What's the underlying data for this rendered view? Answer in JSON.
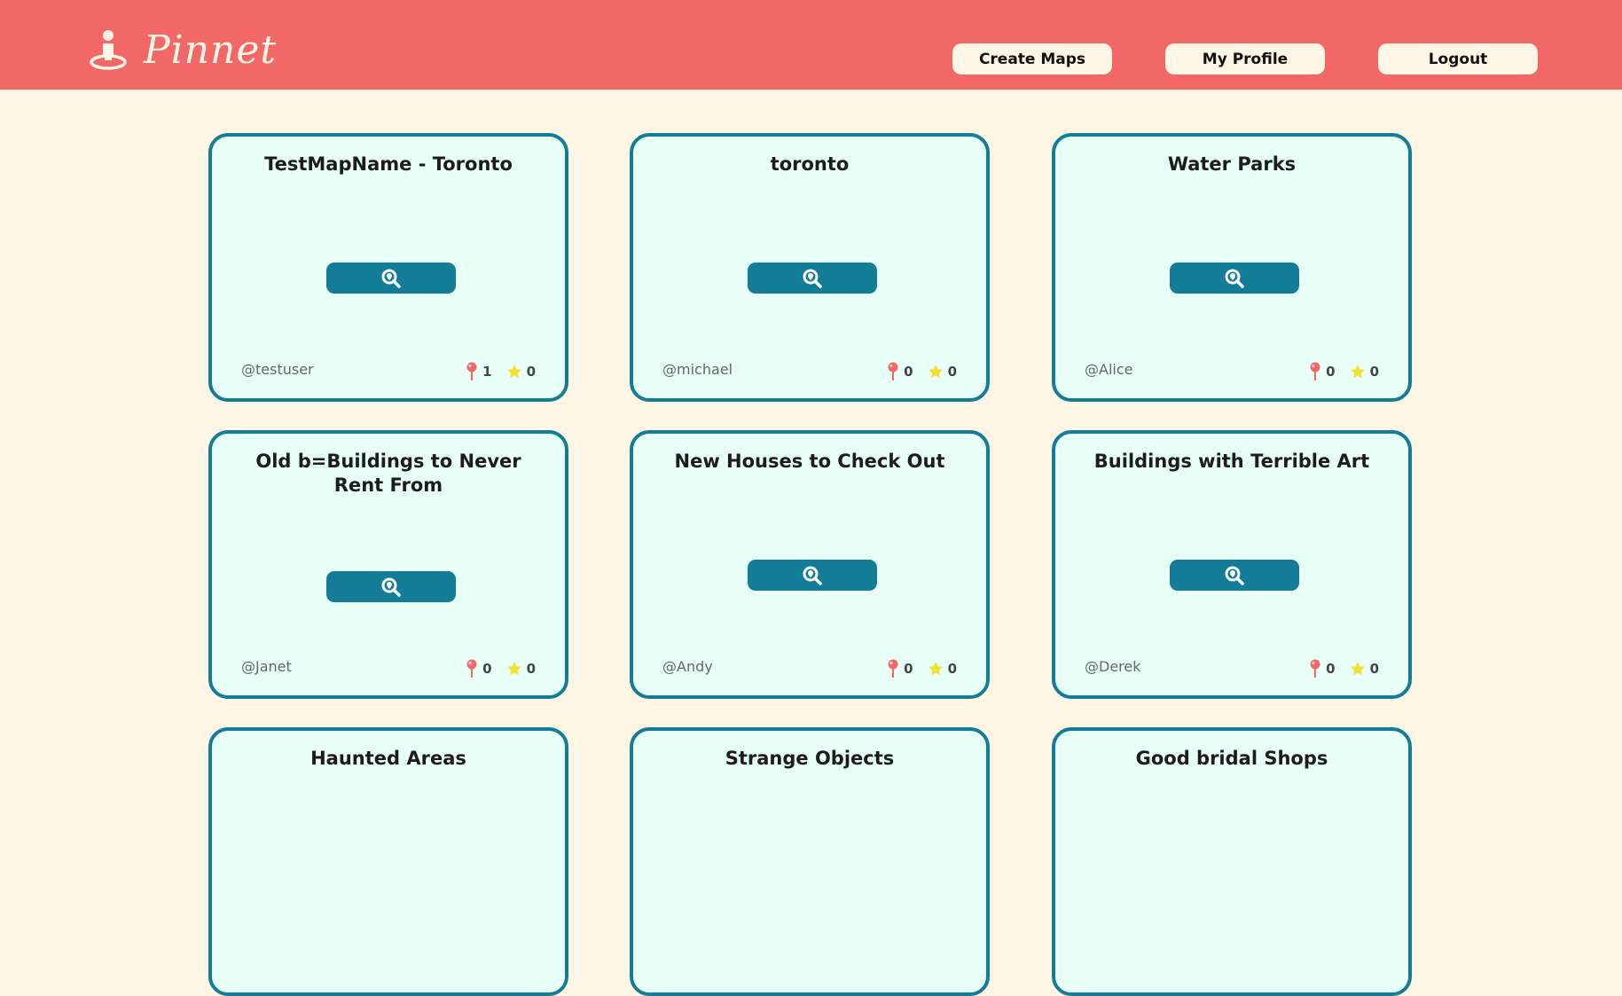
{
  "header": {
    "app_name": "Pinnet",
    "logo_icon": "person-pin-icon",
    "nav": {
      "create_maps": "Create Maps",
      "my_profile": "My Profile",
      "logout": "Logout"
    }
  },
  "colors": {
    "header_bg": "#f26868",
    "page_bg": "#fef5e4",
    "card_bg": "#e8fff8",
    "card_border": "#137c96",
    "button_bg": "#137c96",
    "pin": "#f26868",
    "star": "#f2e130"
  },
  "maps": [
    {
      "title": "TestMapName - Toronto",
      "owner": "@testuser",
      "pins": "1",
      "stars": "0"
    },
    {
      "title": "toronto",
      "owner": "@michael",
      "pins": "0",
      "stars": "0"
    },
    {
      "title": "Water Parks",
      "owner": "@Alice",
      "pins": "0",
      "stars": "0"
    },
    {
      "title": "Old b=Buildings to Never Rent From",
      "owner": "@Janet",
      "pins": "0",
      "stars": "0"
    },
    {
      "title": "New Houses to Check Out",
      "owner": "@Andy",
      "pins": "0",
      "stars": "0"
    },
    {
      "title": "Buildings with Terrible Art",
      "owner": "@Derek",
      "pins": "0",
      "stars": "0"
    },
    {
      "title": "Haunted Areas"
    },
    {
      "title": "Strange Objects"
    },
    {
      "title": "Good bridal Shops"
    }
  ]
}
